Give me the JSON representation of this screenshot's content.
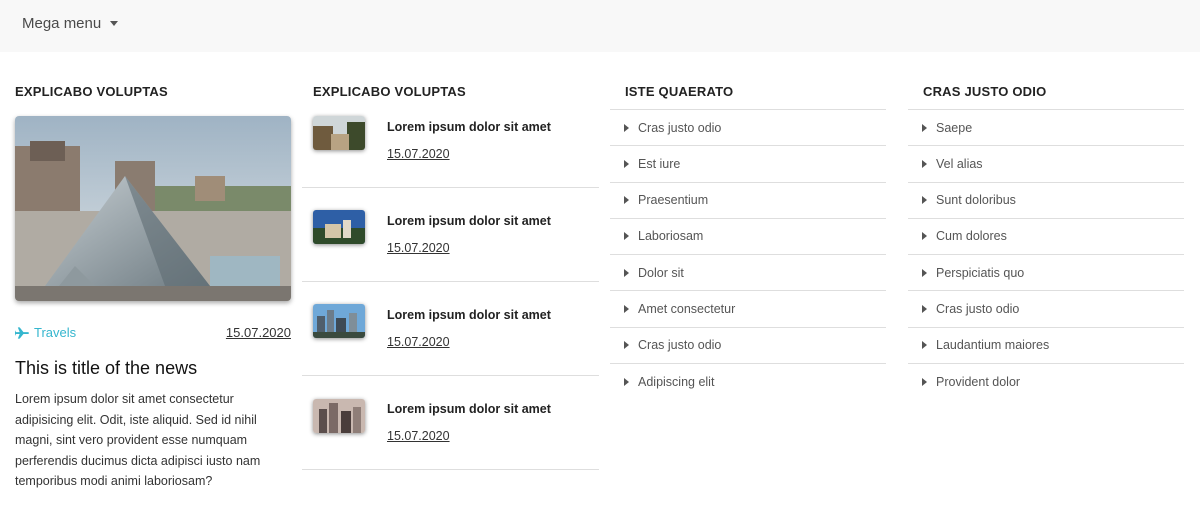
{
  "navbar": {
    "menu_label": "Mega menu"
  },
  "columns": [
    {
      "title": "EXPLICABO VOLUPTAS"
    },
    {
      "title": "EXPLICABO VOLUPTAS"
    },
    {
      "title": "ISTE QUAERATO"
    },
    {
      "title": "CRAS JUSTO ODIO"
    }
  ],
  "feature": {
    "image_icon": "louvre-pyramid-photo",
    "category": "Travels",
    "category_icon": "airplane-icon",
    "date": "15.07.2020",
    "title": "This is title of the news",
    "body": "Lorem ipsum dolor sit amet consectetur adipisicing elit. Odit, iste aliquid. Sed id nihil magni, sint vero provident esse numquam perferendis ducimus dicta adipisci iusto nam temporibus modi animi laboriosam?",
    "accent_color": "#35b6ce"
  },
  "posts": [
    {
      "title": "Lorem ipsum dolor sit amet",
      "date": "15.07.2020"
    },
    {
      "title": "Lorem ipsum dolor sit amet",
      "date": "15.07.2020"
    },
    {
      "title": "Lorem ipsum dolor sit amet",
      "date": "15.07.2020"
    },
    {
      "title": "Lorem ipsum dolor sit amet",
      "date": "15.07.2020"
    }
  ],
  "list_iste": [
    "Cras justo odio",
    "Est iure",
    "Praesentium",
    "Laboriosam",
    "Dolor sit",
    "Amet consectetur",
    "Cras justo odio",
    "Adipiscing elit"
  ],
  "list_cras": [
    "Saepe",
    "Vel alias",
    "Sunt doloribus",
    "Cum dolores",
    "Perspiciatis quo",
    "Cras justo odio",
    "Laudantium maiores",
    "Provident dolor"
  ]
}
